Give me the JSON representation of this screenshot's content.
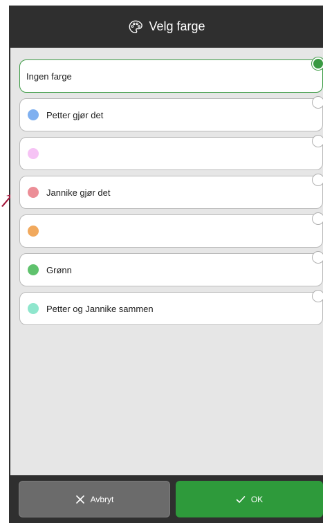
{
  "header": {
    "title": "Velg farge",
    "icon": "palette-icon"
  },
  "options": [
    {
      "label": "Ingen farge",
      "color": null,
      "selected": true
    },
    {
      "label": "Petter gjør det",
      "color": "#7fb0f0",
      "selected": false
    },
    {
      "label": "",
      "color": "#f6c3f5",
      "selected": false
    },
    {
      "label": "Jannike gjør det",
      "color": "#ec8e97",
      "selected": false
    },
    {
      "label": "",
      "color": "#f1a95d",
      "selected": false
    },
    {
      "label": "Grønn",
      "color": "#5fc26d",
      "selected": false
    },
    {
      "label": "Petter og Jannike sammen",
      "color": "#8fe6cd",
      "selected": false
    }
  ],
  "footer": {
    "cancel_label": "Avbryt",
    "ok_label": "OK"
  },
  "colors": {
    "accent": "#3a9a43",
    "header_bg": "#2f2f2f",
    "dialog_bg": "#e6e6e6",
    "cancel_bg": "#6b6b6b",
    "ok_bg": "#2e9a3b",
    "arrow": "#a3163a"
  }
}
